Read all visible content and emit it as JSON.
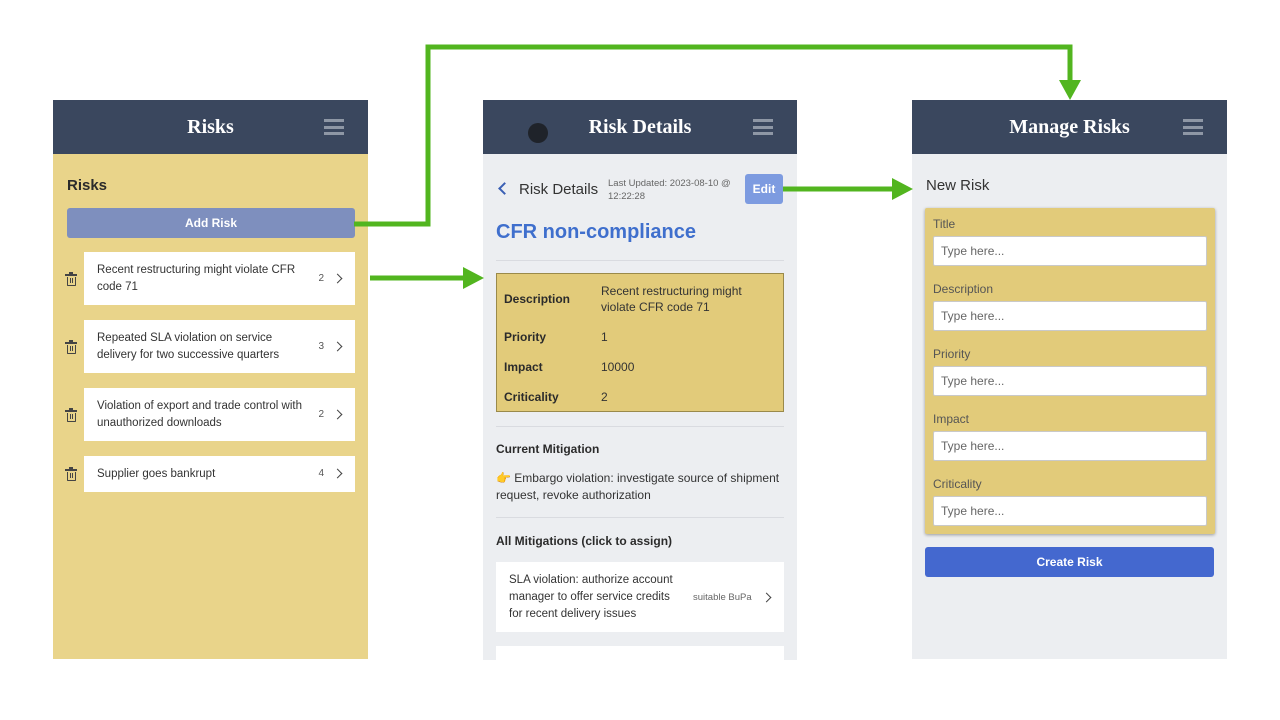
{
  "colors": {
    "arrow": "#52b51f",
    "topbar": "#3a475e",
    "risks_bg": "#e9d48a",
    "detail_bg": "#e2cb7a",
    "title_blue": "#3f6fcd",
    "create_btn": "#4468cf"
  },
  "screen_risks": {
    "topbar_title": "Risks",
    "heading": "Risks",
    "add_button": "Add Risk",
    "items": [
      {
        "text": "Recent restructuring might violate CFR code 71",
        "count": "2"
      },
      {
        "text": "Repeated SLA violation on service delivery for two successive quarters",
        "count": "3"
      },
      {
        "text": "Violation of export and trade control with unauthorized downloads",
        "count": "2"
      },
      {
        "text": "Supplier goes bankrupt",
        "count": "4"
      }
    ]
  },
  "screen_details": {
    "topbar_title": "Risk Details",
    "subtitle": "Risk Details",
    "last_updated": "Last Updated: 2023-08-10 @ 12:22:28",
    "edit_button": "Edit",
    "risk_title": "CFR non-compliance",
    "fields": [
      {
        "label": "Description",
        "value": "Recent restructuring might violate CFR code 71"
      },
      {
        "label": "Priority",
        "value": "1"
      },
      {
        "label": "Impact",
        "value": "10000"
      },
      {
        "label": "Criticality",
        "value": "2"
      }
    ],
    "current_mitigation_heading": "Current Mitigation",
    "current_mitigation": "👉 Embargo violation: investigate source of shipment request, revoke authorization",
    "all_mitigations_heading": "All Mitigations (click to assign)",
    "mitigations": [
      {
        "text": "SLA violation: authorize account manager to offer service credits for recent delivery issues",
        "tag": "suitable BuPa"
      }
    ]
  },
  "screen_manage": {
    "topbar_title": "Manage Risks",
    "heading": "New Risk",
    "fields": [
      {
        "label": "Title",
        "placeholder": "Type here..."
      },
      {
        "label": "Description",
        "placeholder": "Type here..."
      },
      {
        "label": "Priority",
        "placeholder": "Type here..."
      },
      {
        "label": "Impact",
        "placeholder": "Type here..."
      },
      {
        "label": "Criticality",
        "placeholder": "Type here..."
      }
    ],
    "create_button": "Create Risk"
  },
  "icons": [
    "menu-icon",
    "trash-icon",
    "chevron-right-icon",
    "chevron-left-icon",
    "camera-icon",
    "pointing-hand-icon",
    "flow-arrow"
  ]
}
